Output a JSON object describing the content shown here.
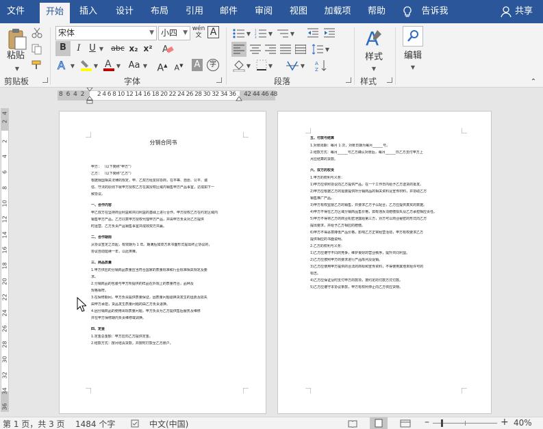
{
  "tabs": [
    "文件",
    "开始",
    "插入",
    "设计",
    "布局",
    "引用",
    "邮件",
    "审阅",
    "视图",
    "加载项",
    "帮助"
  ],
  "tellme": "告诉我",
  "share": "共享",
  "clipboard": {
    "paste": "粘贴",
    "group": "剪贴板"
  },
  "font": {
    "name": "宋体",
    "size": "小四",
    "phonetic": "wén",
    "group": "字体",
    "bold": "B",
    "italic": "I",
    "underline": "U",
    "strike": "abc",
    "subscript": "x₂",
    "superscript": "x²",
    "grow": "A",
    "shrink": "A",
    "case": "Aa",
    "encircle": "字"
  },
  "paragraph": {
    "group": "段落"
  },
  "styles": {
    "label": "样式",
    "group": "样式"
  },
  "editing": {
    "label": "编辑"
  },
  "ruler": {
    "left": "8 6 4 2",
    "mid": "2 4 6 8 10 12 14 16 18 20 22 24 26 28 30 32 34 36 38",
    "right": "42 44 46 48"
  },
  "vruler": [
    "4",
    "2",
    "2",
    "4",
    "6",
    "8",
    "10",
    "12",
    "14",
    "16",
    "18",
    "20",
    "22",
    "24",
    "26",
    "28",
    "30",
    "32",
    "34",
    "36",
    "38",
    "40",
    "42",
    "44",
    "46",
    "48"
  ],
  "page1": {
    "title": "分销合同书",
    "lines": [
      {
        "t": "甲方：                      （以下简称“甲方”）",
        "b": false
      },
      {
        "t": "乙方：                      （以下简称“乙方”）",
        "b": false
      },
      {
        "t": "根据我国相关法律的规定，甲、乙双方经友好协商，在平等、自愿、公平、诚",
        "b": false
      },
      {
        "t": "信、守法的原则下就甲方授权乙方在其授权区域内销售甲方产品事宜，达成如下一",
        "b": false
      },
      {
        "t": "致协议。",
        "b": false
      },
      {
        "t": "一、合作内容",
        "b": true
      },
      {
        "t": "甲乙双方在坚持商业利益和共同利益的基础上进行合作。甲方授权乙方在约定区域内",
        "b": false
      },
      {
        "t": "销售甲方产品，乙方同意甲方授权代理甲方产品，并由甲方负责对乙方提供",
        "b": false
      },
      {
        "t": "时运营、乙方负责产品销售事宜并成效双方共赢。",
        "b": false
      },
      {
        "t": "二、合作期限",
        "b": true
      },
      {
        "t": "从协议签定之日起，有效期为 1 年。期满后如双方未书面形式提出终止协议的，",
        "b": false
      },
      {
        "t": "协议自动延续一年，以此类推。",
        "b": false
      },
      {
        "t": "三、商品质量",
        "b": true
      },
      {
        "t": "1.甲方供应的分销商品质量应当符合国家的质量标准和行业标准相关规定及要",
        "b": false
      },
      {
        "t": "求。",
        "b": false
      },
      {
        "t": "2.分销商品的包装与甲方所提供的样品在外观上的质量符合，品种及",
        "b": false
      },
      {
        "t": "规格相符。",
        "b": false
      },
      {
        "t": "3.在保修期间，甲方负责提供质量保证，因质量问题退换货发生的运费及损失",
        "b": false
      },
      {
        "t": "由甲方承担，货品发生质量问题的由乙方负责退换。",
        "b": false
      },
      {
        "t": "4.因分销商品的使用出现质量问题，甲方负责为乙方提供售后服务及维修",
        "b": false
      },
      {
        "t": "并在甲方保修期内负责维修或调换。",
        "b": false
      },
      {
        "t": "四、定金",
        "b": true
      },
      {
        "t": "1.定金总金额：甲方应向乙方提供定金。",
        "b": false
      },
      {
        "t": "2.结款方式：按月结清货款，并按时打款至乙方账户。",
        "b": false
      }
    ]
  },
  "page2": {
    "lines": [
      {
        "t": "五、付款与结算",
        "b": true
      },
      {
        "t": "1.对账周期：每月 1 次，对账日期为每月______号。",
        "b": false
      },
      {
        "t": "2.结款方式：每月______号乙方确认对账后，每月______日乙方支付甲方上",
        "b": false
      },
      {
        "t": "月应结算的货款。",
        "b": false
      },
      {
        "t": "六、双方的权责",
        "b": true
      },
      {
        "t": "1.甲方的权利与义务：",
        "b": false
      },
      {
        "t": "1)甲方应依照协议向乙方提供产品，在一个工作日内给予乙方送货的批发。",
        "b": false
      },
      {
        "t": "2)甲方应根据乙方的需要提供所分销商品的相关资料及宣传材料，并协助乙方",
        "b": false
      },
      {
        "t": "销售推广产品。",
        "b": false
      },
      {
        "t": "3)甲方有权监督乙方的销售，并要求乙方予以配合，乙方应提供真实的数据。",
        "b": false
      },
      {
        "t": "4)甲方不得在乙方区域分销商品售价格，如有违反须赔偿损失及乙方承担相应责任。",
        "b": false
      },
      {
        "t": "5)甲方不得将乙方的商业机密泄露给第三方，对方可以商业秘密的形式向乙方",
        "b": false
      },
      {
        "t": "提出要求，并给予乙方相应的赔偿。",
        "b": false
      },
      {
        "t": "6)甲方不得恶意降低产品价格，影响乙方正常经营活动，甲方有权要求乙方",
        "b": false
      },
      {
        "t": "提供相应的书面说明。",
        "b": false
      },
      {
        "t": "2.乙方的权利与义务：",
        "b": false
      },
      {
        "t": "1)乙方应遵守不同的竞争，维护良好的营业秩序，提升共同利益。",
        "b": false
      },
      {
        "t": "2)乙方应按照甲方的要求进行产品陈列及促销。",
        "b": false
      },
      {
        "t": "3)乙方应使用甲方提供的合法的商标和宣传资料，不得使用其他未经许可的",
        "b": false
      },
      {
        "t": "标志。",
        "b": false
      },
      {
        "t": "4)乙方应保证及时支付甲方的款项，按约定的付款方式付款。",
        "b": false
      },
      {
        "t": "5)乙方应遵守本协议条款，甲方有权利停止向乙方供应货物。",
        "b": false
      }
    ]
  },
  "status": {
    "page": "第 1 页，共 3 页",
    "words": "1484 个字",
    "lang": "中文(中国)",
    "zoom": "40%"
  }
}
